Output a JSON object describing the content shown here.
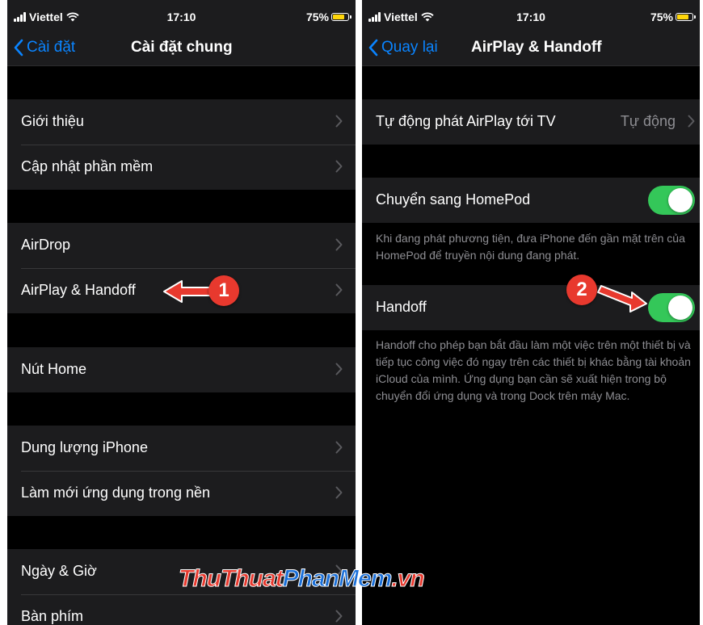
{
  "left_screen": {
    "status": {
      "carrier": "Viettel",
      "time": "17:10",
      "battery": "75%"
    },
    "nav": {
      "back_label": "Cài đặt",
      "title": "Cài đặt chung"
    },
    "groups": [
      [
        "Giới thiệu",
        "Cập nhật phần mềm"
      ],
      [
        "AirDrop",
        "AirPlay & Handoff"
      ],
      [
        "Nút Home"
      ],
      [
        "Dung lượng iPhone",
        "Làm mới ứng dụng trong nền"
      ],
      [
        "Ngày & Giờ",
        "Bàn phím"
      ]
    ],
    "callout": "1"
  },
  "right_screen": {
    "status": {
      "carrier": "Viettel",
      "time": "17:10",
      "battery": "75%"
    },
    "nav": {
      "back_label": "Quay lại",
      "title": "AirPlay & Handoff"
    },
    "airplay_row": {
      "label": "Tự động phát AirPlay tới TV",
      "value": "Tự động"
    },
    "homepod_row": {
      "label": "Chuyển sang HomePod",
      "toggle_on": true
    },
    "homepod_footer": "Khi đang phát phương tiện, đưa iPhone đến gần mặt trên của HomePod để truyền nội dung đang phát.",
    "handoff_row": {
      "label": "Handoff",
      "toggle_on": true
    },
    "handoff_footer": "Handoff cho phép bạn bắt đầu làm một việc trên một thiết bị và tiếp tục công việc đó ngay trên các thiết bị khác bằng tài khoản iCloud của mình. Ứng dụng bạn cần sẽ xuất hiện trong bộ chuyển đổi ứng dụng và trong Dock trên máy Mac.",
    "callout": "2"
  },
  "watermark": {
    "part1": "ThuThuat",
    "part2": "PhanMem",
    "part3": ".vn"
  },
  "colors": {
    "accent": "#0a84ff",
    "toggle_on": "#34c759",
    "callout": "#e8392e",
    "battery": "#ffd60a"
  }
}
